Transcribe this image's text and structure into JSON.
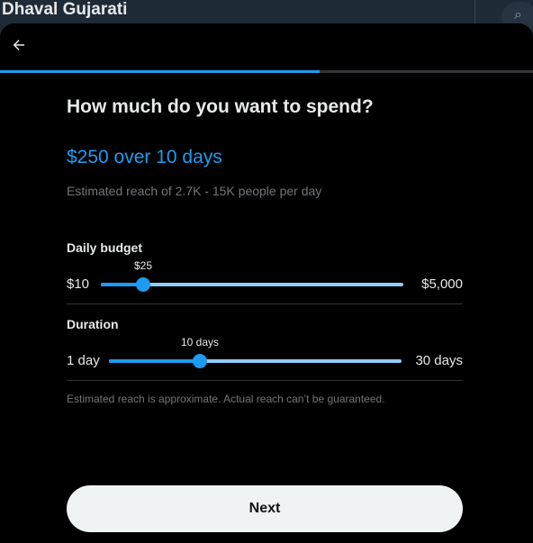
{
  "background": {
    "profile_name": "Dhaval Gujarati",
    "search_icon_glyph": "⌕"
  },
  "modal": {
    "back_icon_glyph": "←",
    "progress_fraction": 0.6,
    "title": "How much do you want to spend?",
    "summary": "$250 over 10 days",
    "reach_text": "Estimated reach of 2.7K - 15K people per day",
    "daily_budget": {
      "label": "Daily budget",
      "min_label": "$10",
      "max_label": "$5,000",
      "current_label": "$25",
      "fraction": 0.14
    },
    "duration": {
      "label": "Duration",
      "min_label": "1 day",
      "max_label": "30 days",
      "current_label": "10 days",
      "fraction": 0.31
    },
    "disclaimer": "Estimated reach is approximate. Actual reach can’t be guaranteed.",
    "next_label": "Next"
  },
  "colors": {
    "accent": "#1d9bf0",
    "track_light": "#8ecdf8",
    "modal_bg": "#000000",
    "page_bg": "#15202b"
  }
}
